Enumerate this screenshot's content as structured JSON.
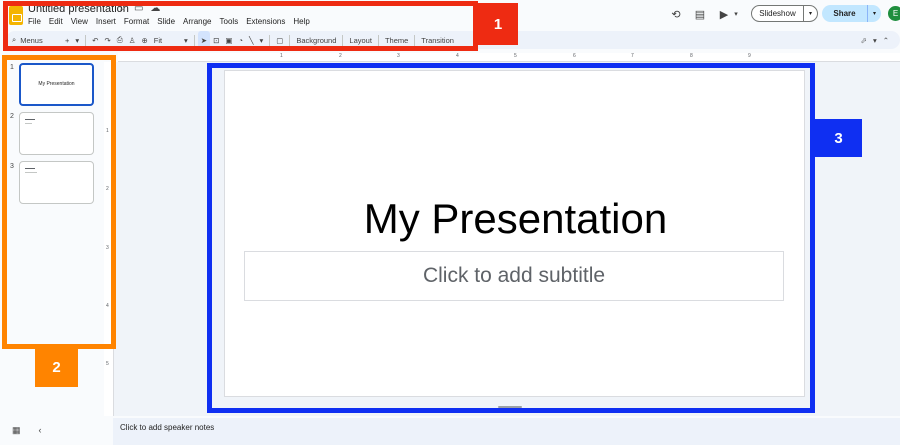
{
  "header": {
    "doc_title": "Untitled presentation",
    "menu": [
      "File",
      "Edit",
      "View",
      "Insert",
      "Format",
      "Slide",
      "Arrange",
      "Tools",
      "Extensions",
      "Help"
    ],
    "slideshow_label": "Slideshow",
    "share_label": "Share",
    "avatar_initial": "E"
  },
  "toolbar": {
    "menus_label": "Menus",
    "zoom_label": "Fit",
    "background_label": "Background",
    "layout_label": "Layout",
    "theme_label": "Theme",
    "transition_label": "Transition"
  },
  "filmstrip": {
    "slides": [
      {
        "num": "1",
        "title": "My Presentation"
      },
      {
        "num": "2",
        "title": ""
      },
      {
        "num": "3",
        "title": ""
      }
    ]
  },
  "slide": {
    "title": "My Presentation",
    "subtitle_placeholder": "Click to add subtitle"
  },
  "notes": {
    "placeholder": "Click to add speaker notes"
  },
  "annotations": {
    "badge_1": "1",
    "badge_2": "2",
    "badge_3": "3",
    "colors": {
      "red": "#ee2b12",
      "orange": "#ff8400",
      "blue": "#0f2ff2"
    }
  },
  "ruler": {
    "h_marks": [
      "1",
      "2",
      "3",
      "4",
      "5",
      "6",
      "7",
      "8",
      "9"
    ],
    "v_marks": [
      "1",
      "2",
      "3",
      "4",
      "5"
    ]
  }
}
